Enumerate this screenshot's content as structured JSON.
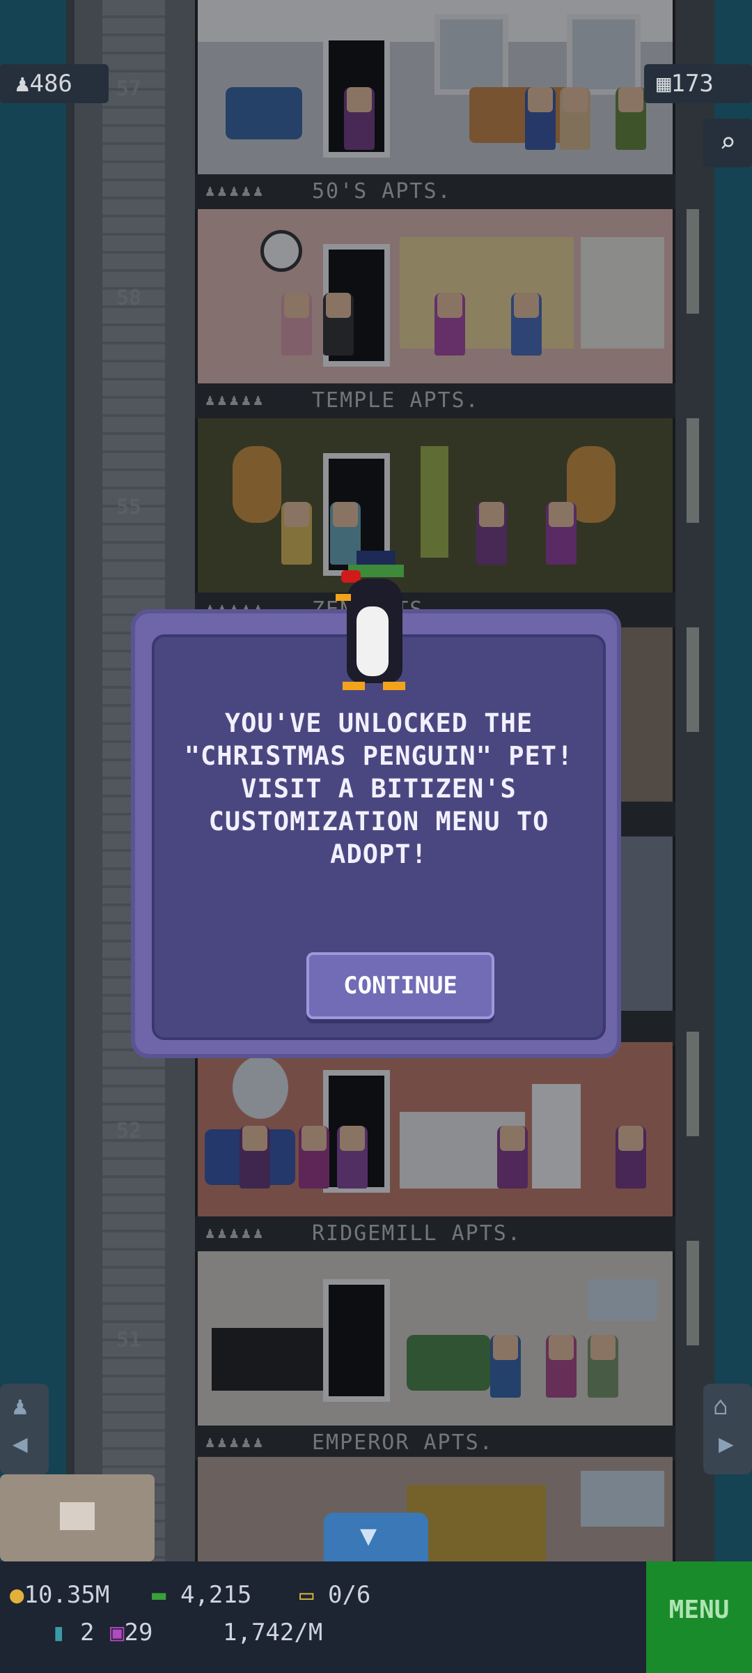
{
  "hud_top": {
    "population": "486",
    "floors": "173"
  },
  "floor_numbers": [
    "57",
    "58",
    "55",
    "52",
    "51"
  ],
  "floors": [
    {
      "name": "50'S APTS."
    },
    {
      "name": "TEMPLE APTS."
    },
    {
      "name": "ZEN APTS."
    },
    {
      "name": "RIDGEMILL APTS."
    },
    {
      "name": "EMPEROR APTS."
    }
  ],
  "modal": {
    "message": "YOU'VE UNLOCKED THE\n\"CHRISTMAS PENGUIN\" PET!\nVISIT A BITIZEN'S\nCUSTOMIZATION MENU TO\nADOPT!",
    "button": "CONTINUE"
  },
  "hud_bottom": {
    "coins": "10.35M",
    "bux": "4,215",
    "tickets": "0/6",
    "keys": "2",
    "tv": "29",
    "rate": "1,742/M",
    "menu": "MENU"
  },
  "colors": {
    "modal_bg": "#4a4780",
    "modal_frame": "#6e66a8",
    "menu_button": "#1a8b2a"
  }
}
